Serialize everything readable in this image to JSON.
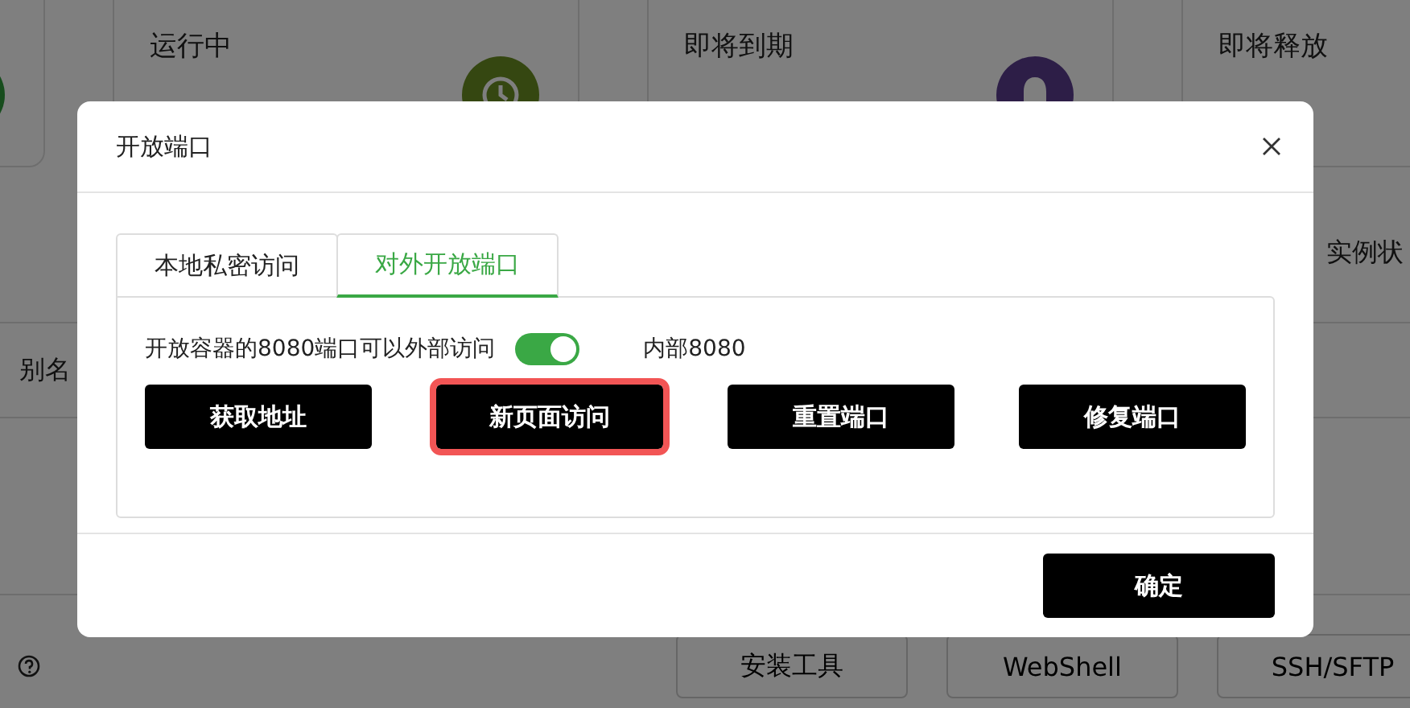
{
  "background": {
    "stat_cards": [
      {
        "title": "运行中"
      },
      {
        "title": "即将到期"
      },
      {
        "title": "即将释放"
      }
    ],
    "status_label": "实例状",
    "alias_label": "别名",
    "actions": [
      "安装工具",
      "WebShell",
      "SSH/SFTP"
    ]
  },
  "dialog": {
    "title": "开放端口",
    "tabs": [
      {
        "label": "本地私密访问",
        "selected": false
      },
      {
        "label": "对外开放端口",
        "selected": true
      }
    ],
    "port_toggle": {
      "label": "开放容器的8080端口可以外部访问",
      "on": true
    },
    "internal_port": "内部8080",
    "buttons": [
      {
        "label": "获取地址",
        "highlighted": false
      },
      {
        "label": "新页面访问",
        "highlighted": true
      },
      {
        "label": "重置端口",
        "highlighted": false
      },
      {
        "label": "修复端口",
        "highlighted": false
      }
    ],
    "confirm": "确定"
  }
}
